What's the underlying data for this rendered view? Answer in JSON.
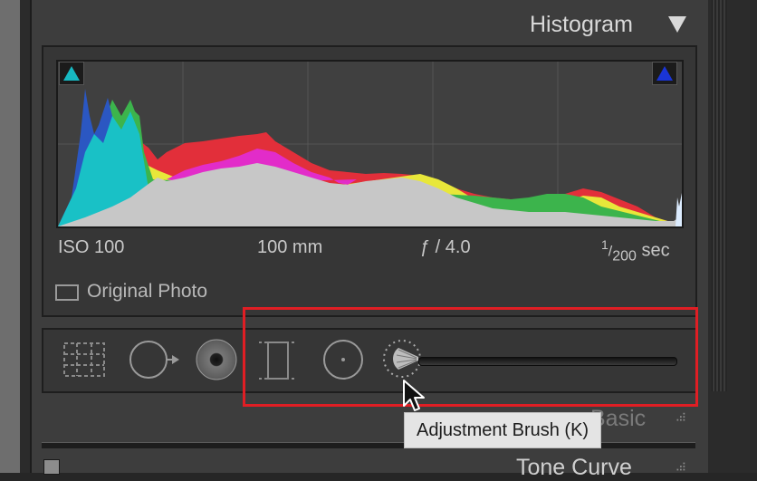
{
  "histogram_panel": {
    "title": "Histogram",
    "exif": {
      "iso": "ISO 100",
      "focal_length": "100 mm",
      "aperture": "ƒ / 4.0",
      "shutter_num": "1",
      "shutter_den": "200",
      "shutter_unit": "sec"
    },
    "original_photo_label": "Original Photo",
    "shadow_clip_color": "#17b9c2",
    "highlight_clip_color": "#1a35d6"
  },
  "tool_strip": {
    "tools": [
      {
        "name": "crop-overlay"
      },
      {
        "name": "spot-removal"
      },
      {
        "name": "red-eye-correction"
      },
      {
        "name": "graduated-filter"
      },
      {
        "name": "radial-filter"
      },
      {
        "name": "adjustment-brush"
      }
    ],
    "highlight_color": "#e01e24"
  },
  "tooltip": {
    "text": "Adjustment Brush (K)"
  },
  "sections": {
    "basic": "Basic",
    "tone_curve": "Tone Curve"
  }
}
